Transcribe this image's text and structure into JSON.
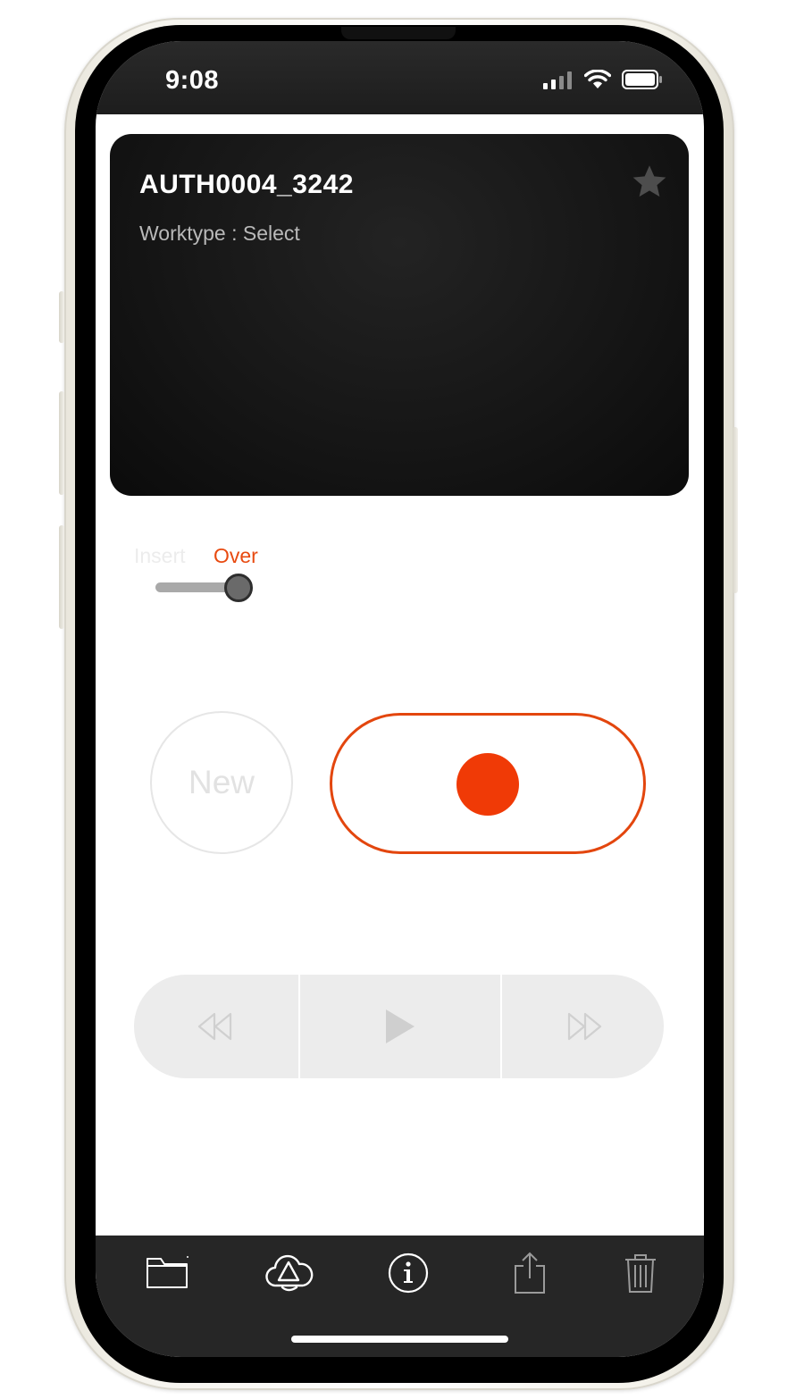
{
  "status_bar": {
    "time": "9:08"
  },
  "recording": {
    "title": "AUTH0004_3242",
    "worktype": "Worktype : Select"
  },
  "mode_switch": {
    "insert_label": "Insert",
    "over_label": "Over",
    "selected": "Over"
  },
  "controls": {
    "new_label": "New"
  },
  "colors": {
    "accent": "#e3460e",
    "record_dot": "#f03a06",
    "card_bg": "#151515",
    "toolbar_bg": "#262626"
  },
  "icons": {
    "status": [
      "cellular-signal-icon",
      "wifi-icon",
      "battery-icon"
    ],
    "card": [
      "star-icon"
    ],
    "playback": [
      "rewind-icon",
      "play-icon",
      "fast-forward-icon"
    ],
    "toolbar": [
      "folder-icon",
      "cloud-sync-icon",
      "info-icon",
      "share-icon",
      "trash-icon"
    ]
  }
}
